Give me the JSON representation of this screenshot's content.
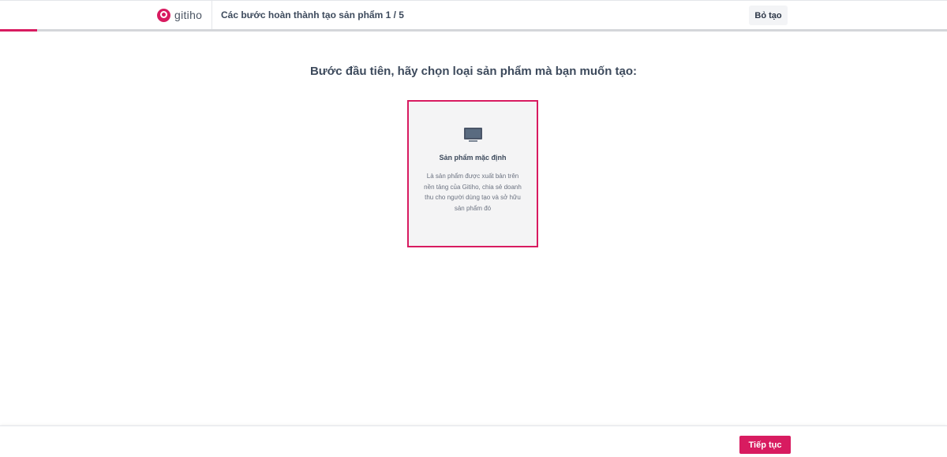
{
  "header": {
    "logo_text": "gitiho",
    "step_title": "Các bước hoàn thành tạo sản phẩm 1 / 5",
    "cancel_label": "Bỏ tạo",
    "progress": {
      "current": 1,
      "total": 5
    }
  },
  "main": {
    "question": "Bước đầu tiên, hãy chọn loại sản phẩm mà bạn muốn tạo:",
    "product_types": [
      {
        "icon": "monitor-icon",
        "title": "Sản phẩm mặc định",
        "description": "Là sản phẩm được xuất bản trên nền tảng của Gitiho, chia sẻ doanh thu cho người dùng tạo và sở hữu sản phẩm đó",
        "selected": true
      }
    ]
  },
  "footer": {
    "next_label": "Tiếp tục"
  },
  "colors": {
    "accent": "#d81b60",
    "text": "#3d4a5c",
    "card_bg": "#f4f4f5"
  }
}
